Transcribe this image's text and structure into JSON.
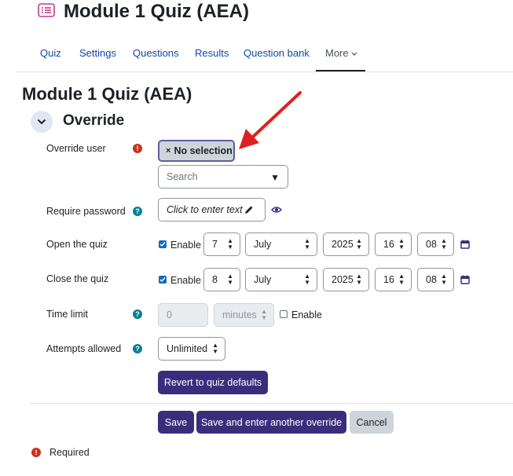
{
  "header": {
    "title": "Module 1 Quiz (AEA)"
  },
  "nav": {
    "tabs": [
      "Quiz",
      "Settings",
      "Questions",
      "Results",
      "Question bank",
      "More"
    ]
  },
  "section": {
    "title": "Module 1 Quiz (AEA)",
    "legend": "Override"
  },
  "form": {
    "override_user": {
      "label": "Override user",
      "selection": "No selection",
      "remove_glyph": "×",
      "search_placeholder": "Search"
    },
    "require_password": {
      "label": "Require password",
      "placeholder": "Click to enter text"
    },
    "open_quiz": {
      "label": "Open the quiz",
      "enable": "Enable",
      "day": "7",
      "month": "July",
      "year": "2025",
      "hour": "16",
      "minute": "08",
      "enabled": true
    },
    "close_quiz": {
      "label": "Close the quiz",
      "enable": "Enable",
      "day": "8",
      "month": "July",
      "year": "2025",
      "hour": "16",
      "minute": "08",
      "enabled": true
    },
    "time_limit": {
      "label": "Time limit",
      "value": "0",
      "unit": "minutes",
      "enable": "Enable",
      "enabled": false
    },
    "attempts": {
      "label": "Attempts allowed",
      "value": "Unlimited"
    },
    "revert_button": "Revert to quiz defaults"
  },
  "actions": {
    "save": "Save",
    "save_another": "Save and enter another override",
    "cancel": "Cancel"
  },
  "footer": {
    "required_note": "Required"
  },
  "icons": {
    "page": "quiz-page-icon",
    "collapse": "chevron-down-icon",
    "required": "required-icon",
    "help": "help-icon",
    "edit": "pencil-icon",
    "reveal": "eye-icon",
    "calendar": "calendar-icon",
    "annotation": "red-arrow"
  },
  "colors": {
    "primary": "#3a2d7c",
    "link": "#0f47ad",
    "required": "#ca3120",
    "help": "#008196",
    "annotation": "#e02020"
  }
}
